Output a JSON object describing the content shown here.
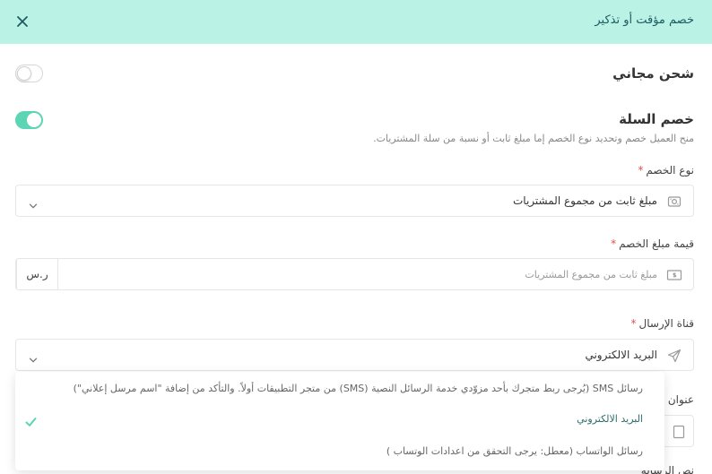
{
  "header": {
    "title": "خصم مؤقت أو تذكير"
  },
  "free_shipping": {
    "title": "شحن مجاني",
    "enabled": false
  },
  "cart_discount": {
    "title": "خصم السلة",
    "description": "منح العميل خصم وتحديد نوع الخصم إما مبلغ ثابت أو نسبة من سلة المشتريات.",
    "enabled": true
  },
  "discount_type": {
    "label": "نوع الخصم",
    "required_mark": "*",
    "value": "مبلغ ثابت من مجموع المشتريات",
    "icon": "money-icon"
  },
  "discount_amount": {
    "label": "قيمة مبلغ الخصم",
    "required_mark": "*",
    "placeholder": "مبلغ ثابت من مجموع المشتريات",
    "value": "",
    "currency": "ر.س",
    "icon": "cash-icon"
  },
  "send_channel": {
    "label": "قناة الإرسال",
    "required_mark": "*",
    "value": "البريد الالكتروني",
    "icon": "send-icon",
    "options": [
      {
        "label": "رسائل SMS (يُرجى ربط متجرك بأحد مزوّدي خدمة الرسائل النصية (SMS) من متجر التطبيقات أولاً. والتأكد من إضافة \"اسم مرسل إعلاني\")",
        "state": "disabled"
      },
      {
        "label": "البريد الالكتروني",
        "state": "selected"
      },
      {
        "label": "رسائل الواتساب (معطل: يرجى التحقق من اعدادات الوتساب )",
        "state": "disabled"
      }
    ]
  },
  "background_fields": {
    "title_label": "عنوان",
    "message_label": "نص الرسالة"
  },
  "colors": {
    "header_bg": "#baf3e6",
    "accent": "#5dd5b5",
    "required": "#e25050",
    "check": "#5dd5b5"
  }
}
